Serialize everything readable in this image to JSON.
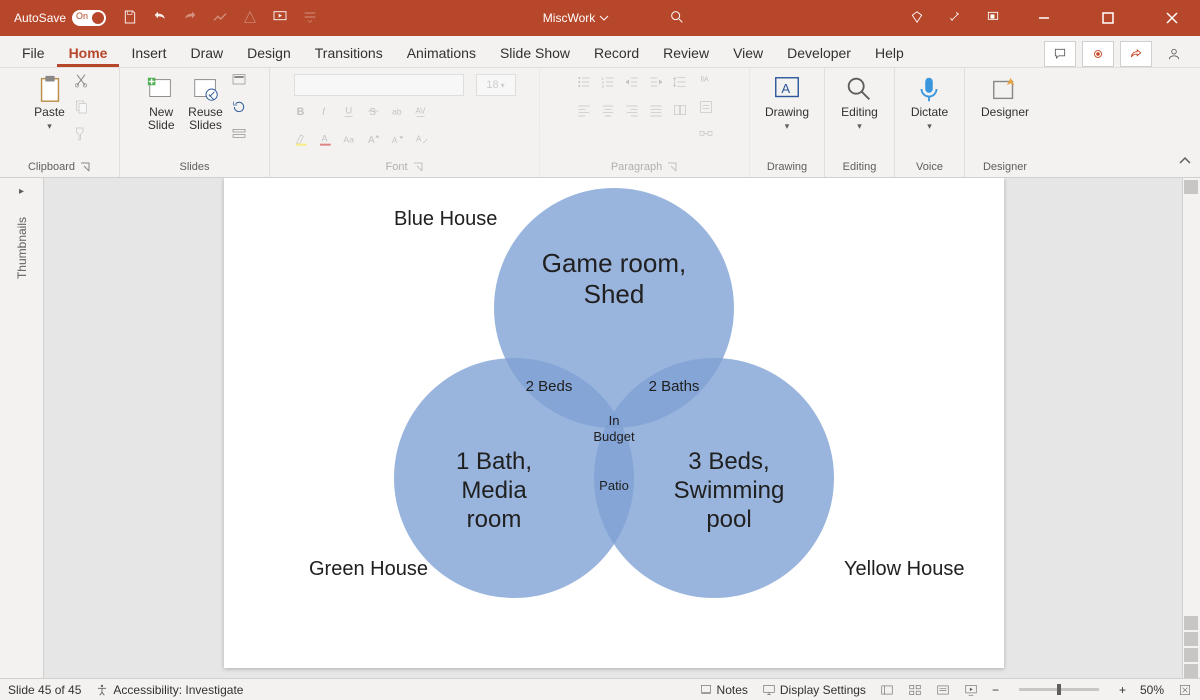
{
  "titlebar": {
    "autosave_label": "AutoSave",
    "autosave_state": "On",
    "doc_name": "MiscWork"
  },
  "tabs": {
    "file": "File",
    "home": "Home",
    "insert": "Insert",
    "draw": "Draw",
    "design": "Design",
    "transitions": "Transitions",
    "animations": "Animations",
    "slideshow": "Slide Show",
    "record": "Record",
    "review": "Review",
    "view": "View",
    "developer": "Developer",
    "help": "Help"
  },
  "ribbon": {
    "clipboard": {
      "label": "Clipboard",
      "paste": "Paste"
    },
    "slides": {
      "label": "Slides",
      "new_slide": "New\nSlide",
      "reuse": "Reuse\nSlides"
    },
    "font": {
      "label": "Font",
      "size_placeholder": "18"
    },
    "paragraph": {
      "label": "Paragraph"
    },
    "drawing": {
      "label": "Drawing",
      "btn": "Drawing"
    },
    "editing": {
      "label": "Editing",
      "btn": "Editing"
    },
    "voice": {
      "label": "Voice",
      "btn": "Dictate"
    },
    "designer": {
      "label": "Designer",
      "btn": "Designer"
    }
  },
  "thumb_label": "Thumbnails",
  "slide": {
    "labels": {
      "blue": "Blue House",
      "green": "Green House",
      "yellow": "Yellow House"
    },
    "top": "Game room,\nShed",
    "left": "1 Bath,\nMedia\nroom",
    "right": "3 Beds,\nSwimming\npool",
    "tl": "2 Beds",
    "tr": "2 Baths",
    "center": "In\nBudget",
    "bottom": "Patio"
  },
  "status": {
    "slide_counter": "Slide 45 of 45",
    "accessibility": "Accessibility: Investigate",
    "notes": "Notes",
    "display": "Display Settings",
    "zoom": "50%"
  },
  "chart_data": {
    "type": "venn3",
    "sets": [
      {
        "name": "Blue House",
        "only": "Game room, Shed"
      },
      {
        "name": "Green House",
        "only": "1 Bath, Media room"
      },
      {
        "name": "Yellow House",
        "only": "3 Beds, Swimming pool"
      }
    ],
    "pairwise": {
      "Blue∩Green": "2 Beds",
      "Blue∩Yellow": "2 Baths",
      "Green∩Yellow": "Patio"
    },
    "all_three": "In Budget"
  }
}
